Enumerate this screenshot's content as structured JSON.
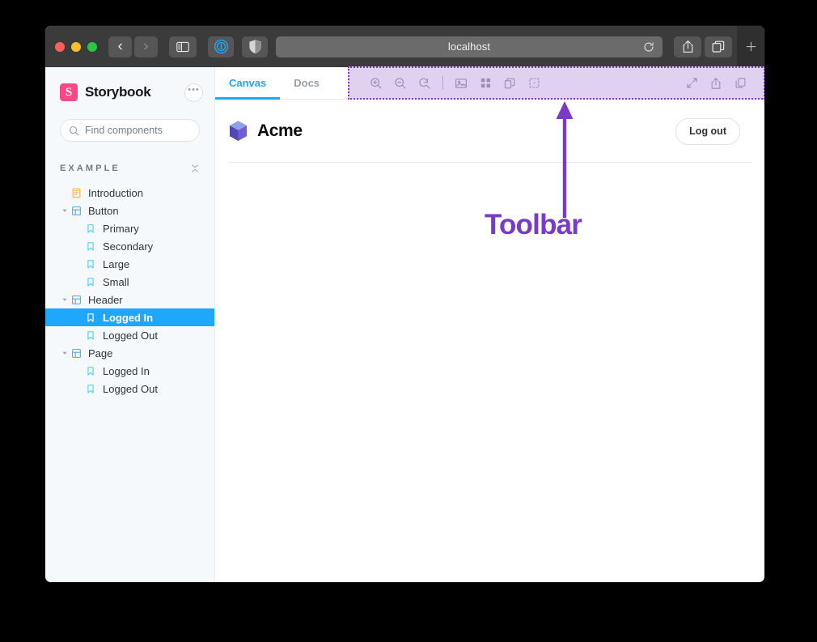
{
  "browser": {
    "url": "localhost",
    "back_label": "Back",
    "forward_label": "Forward",
    "sidebar_toggle_label": "Show sidebar",
    "extension_1password_label": "1Password",
    "reader_label": "Reader",
    "reload_label": "Reload",
    "share_label": "Share",
    "tab_overview_label": "Tab overview",
    "new_tab_label": "+"
  },
  "sidebar": {
    "brand": "Storybook",
    "logo_glyph": "S",
    "menu_label": "•••",
    "search": {
      "placeholder": "Find components",
      "value": "",
      "shortcut": "/"
    },
    "group_title": "EXAMPLE",
    "items": [
      {
        "label": "Introduction",
        "type": "doc",
        "depth": 0,
        "expandable": false,
        "selected": false
      },
      {
        "label": "Button",
        "type": "component",
        "depth": 0,
        "expandable": true,
        "selected": false
      },
      {
        "label": "Primary",
        "type": "story",
        "depth": 1,
        "expandable": false,
        "selected": false
      },
      {
        "label": "Secondary",
        "type": "story",
        "depth": 1,
        "expandable": false,
        "selected": false
      },
      {
        "label": "Large",
        "type": "story",
        "depth": 1,
        "expandable": false,
        "selected": false
      },
      {
        "label": "Small",
        "type": "story",
        "depth": 1,
        "expandable": false,
        "selected": false
      },
      {
        "label": "Header",
        "type": "component",
        "depth": 0,
        "expandable": true,
        "selected": false
      },
      {
        "label": "Logged In",
        "type": "story",
        "depth": 1,
        "expandable": false,
        "selected": true
      },
      {
        "label": "Logged Out",
        "type": "story",
        "depth": 1,
        "expandable": false,
        "selected": false
      },
      {
        "label": "Page",
        "type": "component",
        "depth": 0,
        "expandable": true,
        "selected": false
      },
      {
        "label": "Logged In",
        "type": "story",
        "depth": 1,
        "expandable": false,
        "selected": false
      },
      {
        "label": "Logged Out",
        "type": "story",
        "depth": 1,
        "expandable": false,
        "selected": false
      }
    ]
  },
  "preview": {
    "tabs": [
      {
        "label": "Canvas",
        "active": true
      },
      {
        "label": "Docs",
        "active": false
      }
    ],
    "toolbar": {
      "left_buttons": [
        {
          "name": "zoom-in-icon",
          "label": "Zoom in"
        },
        {
          "name": "zoom-out-icon",
          "label": "Zoom out"
        },
        {
          "name": "zoom-reset-icon",
          "label": "Reset zoom"
        }
      ],
      "mid_buttons": [
        {
          "name": "background-icon",
          "label": "Change background"
        },
        {
          "name": "grid-icon",
          "label": "Apply grid"
        },
        {
          "name": "viewport-icon",
          "label": "Change viewport"
        },
        {
          "name": "measure-icon",
          "label": "Enable measure"
        }
      ],
      "right_buttons": [
        {
          "name": "fullscreen-icon",
          "label": "Go full screen"
        },
        {
          "name": "open-new-tab-icon",
          "label": "Open canvas in new tab"
        },
        {
          "name": "copy-link-icon",
          "label": "Copy canvas link"
        }
      ]
    }
  },
  "canvas": {
    "brand_name": "Acme",
    "logout_label": "Log out"
  },
  "annotation": {
    "label": "Toolbar"
  },
  "colors": {
    "accent_blue": "#1EA7FD",
    "brand_pink": "#FF4785",
    "annotation_purple": "#7A3BC4",
    "toolbar_highlight": "#DFD1F0",
    "sidebar_bg": "#F6F9FC"
  }
}
